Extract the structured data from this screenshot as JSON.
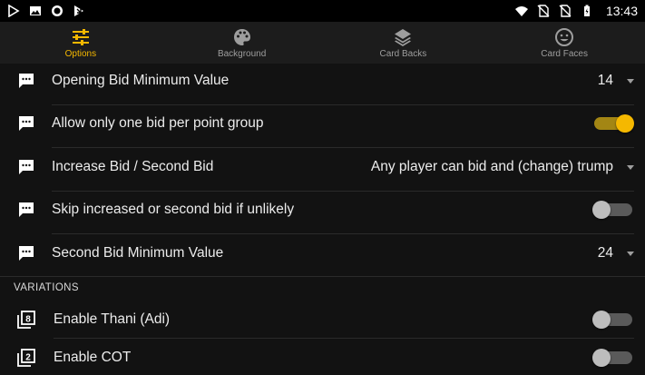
{
  "status_bar": {
    "left_icons": [
      "play-store-icon",
      "image-icon",
      "circle-icon",
      "download-icon"
    ],
    "right_icons": [
      "wifi-icon",
      "no-sim-icon",
      "no-sim-icon",
      "battery-icon"
    ],
    "time": "13:43"
  },
  "tabs": [
    {
      "label": "Options",
      "icon": "sliders-icon",
      "active": true
    },
    {
      "label": "Background",
      "icon": "palette-icon",
      "active": false
    },
    {
      "label": "Card Backs",
      "icon": "layers-icon",
      "active": false
    },
    {
      "label": "Card Faces",
      "icon": "smiley-icon",
      "active": false
    }
  ],
  "settings": [
    {
      "label": "Opening Bid Minimum Value",
      "type": "dropdown",
      "value": "14",
      "icon": "comment-icon"
    },
    {
      "label": "Allow only one bid per point group",
      "type": "switch",
      "checked": true,
      "icon": "comment-icon"
    },
    {
      "label": "Increase Bid / Second Bid",
      "type": "dropdown",
      "value": "Any player can bid and (change) trump",
      "icon": "comment-icon"
    },
    {
      "label": "Skip increased or second bid if unlikely",
      "type": "switch",
      "checked": false,
      "icon": "comment-icon"
    },
    {
      "label": "Second Bid Minimum Value",
      "type": "dropdown",
      "value": "24",
      "icon": "comment-icon"
    }
  ],
  "variations_header": "VARIATIONS",
  "variations": [
    {
      "label": "Enable Thani (Adi)",
      "type": "switch",
      "checked": false,
      "icon": "filter-8-icon",
      "badge": "8"
    },
    {
      "label": "Enable COT",
      "type": "switch",
      "checked": false,
      "icon": "filter-2-icon",
      "badge": "2"
    }
  ],
  "colors": {
    "accent": "#f5b800",
    "background": "#121212",
    "tabbar": "#1c1c1c"
  }
}
